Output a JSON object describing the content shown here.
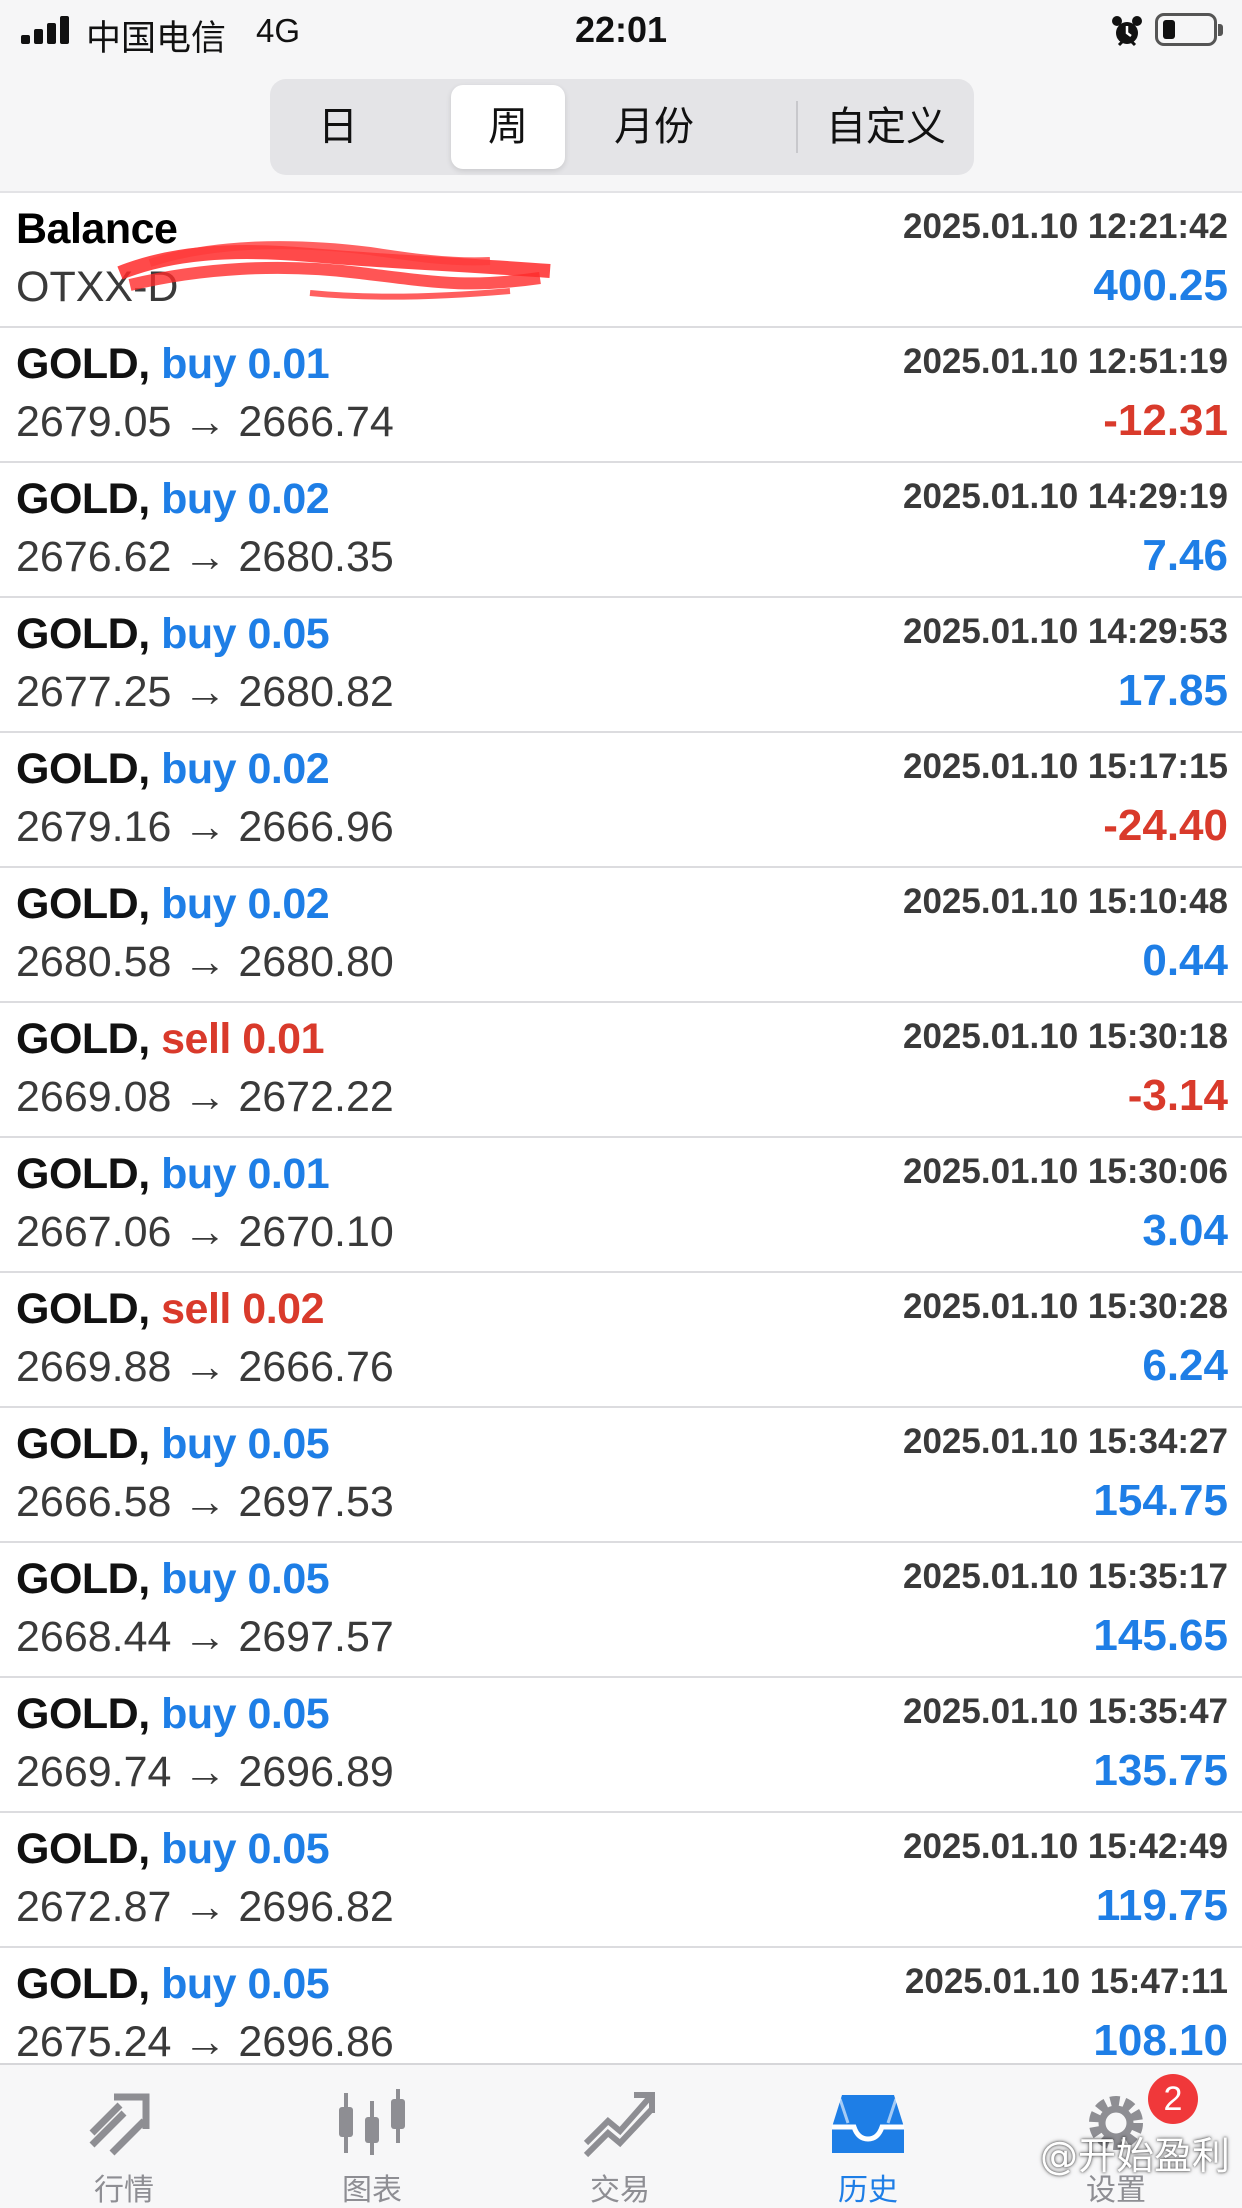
{
  "status_bar": {
    "carrier": "中国电信",
    "network": "4G",
    "time": "22:01"
  },
  "period_tabs": [
    "日",
    "周",
    "月份",
    "自定义"
  ],
  "selected_period": "周",
  "balance": {
    "title": "Balance",
    "account": "OTXX-D",
    "time": "2025.01.10 12:21:42",
    "amount": "400.25"
  },
  "deals": [
    {
      "symbol": "GOLD,",
      "side": "buy 0.01",
      "type": "buy",
      "open": "2679.05",
      "close": "2666.74",
      "time": "2025.01.10 12:51:19",
      "profit": "-12.31"
    },
    {
      "symbol": "GOLD,",
      "side": "buy 0.02",
      "type": "buy",
      "open": "2676.62",
      "close": "2680.35",
      "time": "2025.01.10 14:29:19",
      "profit": "7.46"
    },
    {
      "symbol": "GOLD,",
      "side": "buy 0.05",
      "type": "buy",
      "open": "2677.25",
      "close": "2680.82",
      "time": "2025.01.10 14:29:53",
      "profit": "17.85"
    },
    {
      "symbol": "GOLD,",
      "side": "buy 0.02",
      "type": "buy",
      "open": "2679.16",
      "close": "2666.96",
      "time": "2025.01.10 15:17:15",
      "profit": "-24.40"
    },
    {
      "symbol": "GOLD,",
      "side": "buy 0.02",
      "type": "buy",
      "open": "2680.58",
      "close": "2680.80",
      "time": "2025.01.10 15:10:48",
      "profit": "0.44"
    },
    {
      "symbol": "GOLD,",
      "side": "sell 0.01",
      "type": "sell",
      "open": "2669.08",
      "close": "2672.22",
      "time": "2025.01.10 15:30:18",
      "profit": "-3.14"
    },
    {
      "symbol": "GOLD,",
      "side": "buy 0.01",
      "type": "buy",
      "open": "2667.06",
      "close": "2670.10",
      "time": "2025.01.10 15:30:06",
      "profit": "3.04"
    },
    {
      "symbol": "GOLD,",
      "side": "sell 0.02",
      "type": "sell",
      "open": "2669.88",
      "close": "2666.76",
      "time": "2025.01.10 15:30:28",
      "profit": "6.24"
    },
    {
      "symbol": "GOLD,",
      "side": "buy 0.05",
      "type": "buy",
      "open": "2666.58",
      "close": "2697.53",
      "time": "2025.01.10 15:34:27",
      "profit": "154.75"
    },
    {
      "symbol": "GOLD,",
      "side": "buy 0.05",
      "type": "buy",
      "open": "2668.44",
      "close": "2697.57",
      "time": "2025.01.10 15:35:17",
      "profit": "145.65"
    },
    {
      "symbol": "GOLD,",
      "side": "buy 0.05",
      "type": "buy",
      "open": "2669.74",
      "close": "2696.89",
      "time": "2025.01.10 15:35:47",
      "profit": "135.75"
    },
    {
      "symbol": "GOLD,",
      "side": "buy 0.05",
      "type": "buy",
      "open": "2672.87",
      "close": "2696.82",
      "time": "2025.01.10 15:42:49",
      "profit": "119.75"
    },
    {
      "symbol": "GOLD,",
      "side": "buy 0.05",
      "type": "buy",
      "open": "2675.24",
      "close": "2696.86",
      "time": "2025.01.10 15:47:11",
      "profit": "108.10"
    }
  ],
  "price_arrow": "→",
  "bottom_tabs": [
    {
      "label": "行情",
      "icon": "quotes-icon"
    },
    {
      "label": "图表",
      "icon": "chart-icon"
    },
    {
      "label": "交易",
      "icon": "trade-icon"
    },
    {
      "label": "历史",
      "icon": "history-icon"
    },
    {
      "label": "设置",
      "icon": "settings-icon"
    }
  ],
  "active_bottom_tab": "历史",
  "settings_badge": "2",
  "watermark": "@开始盈利",
  "colors": {
    "buy": "#1e7ee6",
    "sell": "#d93a2b",
    "profit_positive": "#1e7ee6",
    "profit_negative": "#d93a2b",
    "active_tab": "#1e7ee6"
  }
}
